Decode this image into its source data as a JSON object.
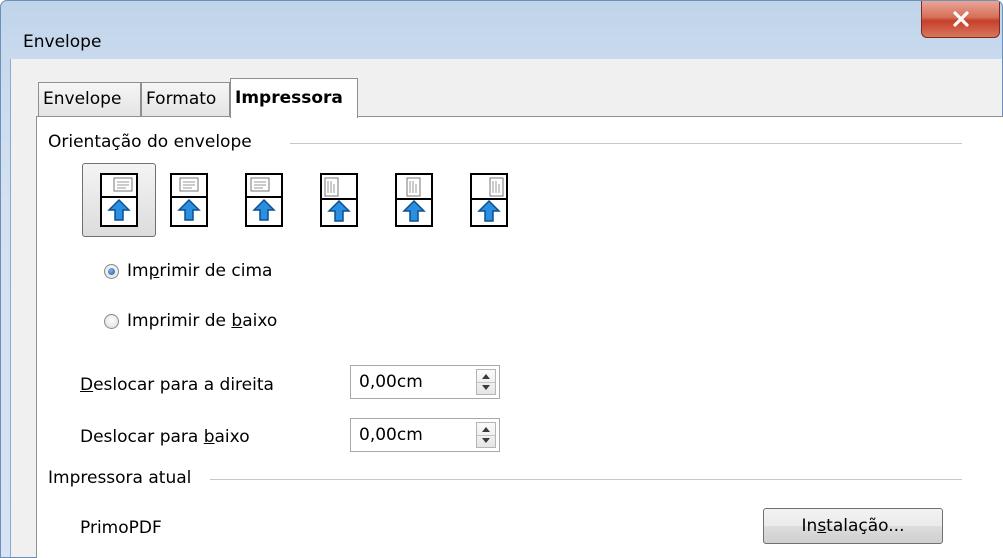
{
  "window": {
    "title": "Envelope"
  },
  "tabs": [
    {
      "label": "Envelope",
      "active": false
    },
    {
      "label": "Formato",
      "active": false
    },
    {
      "label": "Impressora",
      "active": true
    }
  ],
  "orientation": {
    "section_label": "Orientação do envelope",
    "options": [
      {
        "name": "horizontal-left",
        "selected": true
      },
      {
        "name": "horizontal-center",
        "selected": false
      },
      {
        "name": "horizontal-right",
        "selected": false
      },
      {
        "name": "vertical-left",
        "selected": false
      },
      {
        "name": "vertical-center",
        "selected": false
      },
      {
        "name": "vertical-right",
        "selected": false
      }
    ],
    "print_from_top": {
      "label_before": "Im",
      "mnemonic": "p",
      "label_after": "rimir de cima",
      "checked": true
    },
    "print_from_bottom": {
      "label_before": "Imprimir de ",
      "mnemonic": "b",
      "label_after": "aixo",
      "checked": false
    }
  },
  "shift_right": {
    "label_before": "",
    "mnemonic": "D",
    "label_after": "eslocar para a direita",
    "value": "0,00cm"
  },
  "shift_down": {
    "label_before": "Deslocar para ",
    "mnemonic": "b",
    "label_after": "aixo",
    "value": "0,00cm"
  },
  "current_printer": {
    "section_label": "Impressora atual",
    "name": "PrimoPDF",
    "setup_button": {
      "label_before": "In",
      "mnemonic": "s",
      "label_after": "talação..."
    }
  },
  "colors": {
    "accent_radio": "#1d5aa8",
    "arrow_fill": "#2a8fe0",
    "close_button": "#c6402a"
  }
}
